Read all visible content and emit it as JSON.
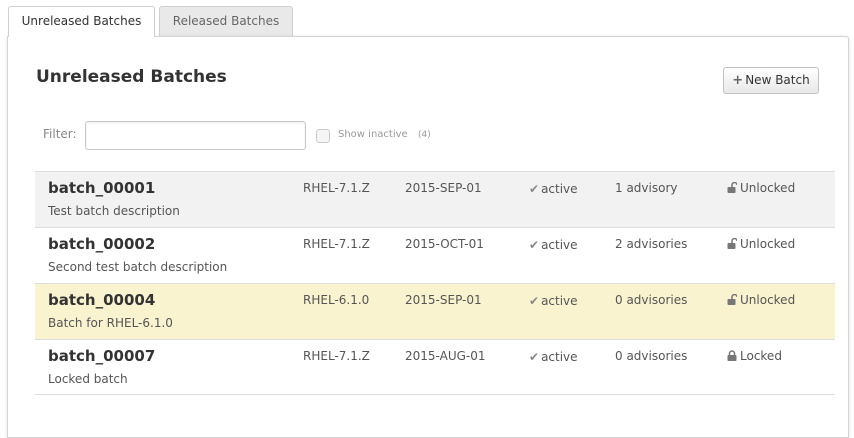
{
  "tabs": [
    {
      "label": "Unreleased Batches",
      "active": true
    },
    {
      "label": "Released Batches",
      "active": false
    }
  ],
  "page": {
    "title": "Unreleased Batches"
  },
  "toolbar": {
    "new_batch_label": "New Batch",
    "new_batch_icon": "plus-icon"
  },
  "filter": {
    "label": "Filter:",
    "value": "",
    "show_inactive_label": "Show inactive",
    "show_inactive_checked": false,
    "inactive_count": "(4)"
  },
  "colors": {
    "highlight_row": "#f9f3cf",
    "alt_row": "#f2f2f2"
  },
  "batches": [
    {
      "name": "batch_00001",
      "description": "Test batch description",
      "release": "RHEL-7.1.Z",
      "date": "2015-SEP-01",
      "state": "active",
      "advisories": "1 advisory",
      "lock_status": "Unlocked",
      "lock_icon": "unlock-icon"
    },
    {
      "name": "batch_00002",
      "description": "Second test batch description",
      "release": "RHEL-7.1.Z",
      "date": "2015-OCT-01",
      "state": "active",
      "advisories": "2 advisories",
      "lock_status": "Unlocked",
      "lock_icon": "unlock-icon"
    },
    {
      "name": "batch_00004",
      "description": "Batch for RHEL-6.1.0",
      "release": "RHEL-6.1.0",
      "date": "2015-SEP-01",
      "state": "active",
      "advisories": "0 advisories",
      "lock_status": "Unlocked",
      "lock_icon": "unlock-icon"
    },
    {
      "name": "batch_00007",
      "description": "Locked batch",
      "release": "RHEL-7.1.Z",
      "date": "2015-AUG-01",
      "state": "active",
      "advisories": "0 advisories",
      "lock_status": "Locked",
      "lock_icon": "lock-icon"
    }
  ]
}
